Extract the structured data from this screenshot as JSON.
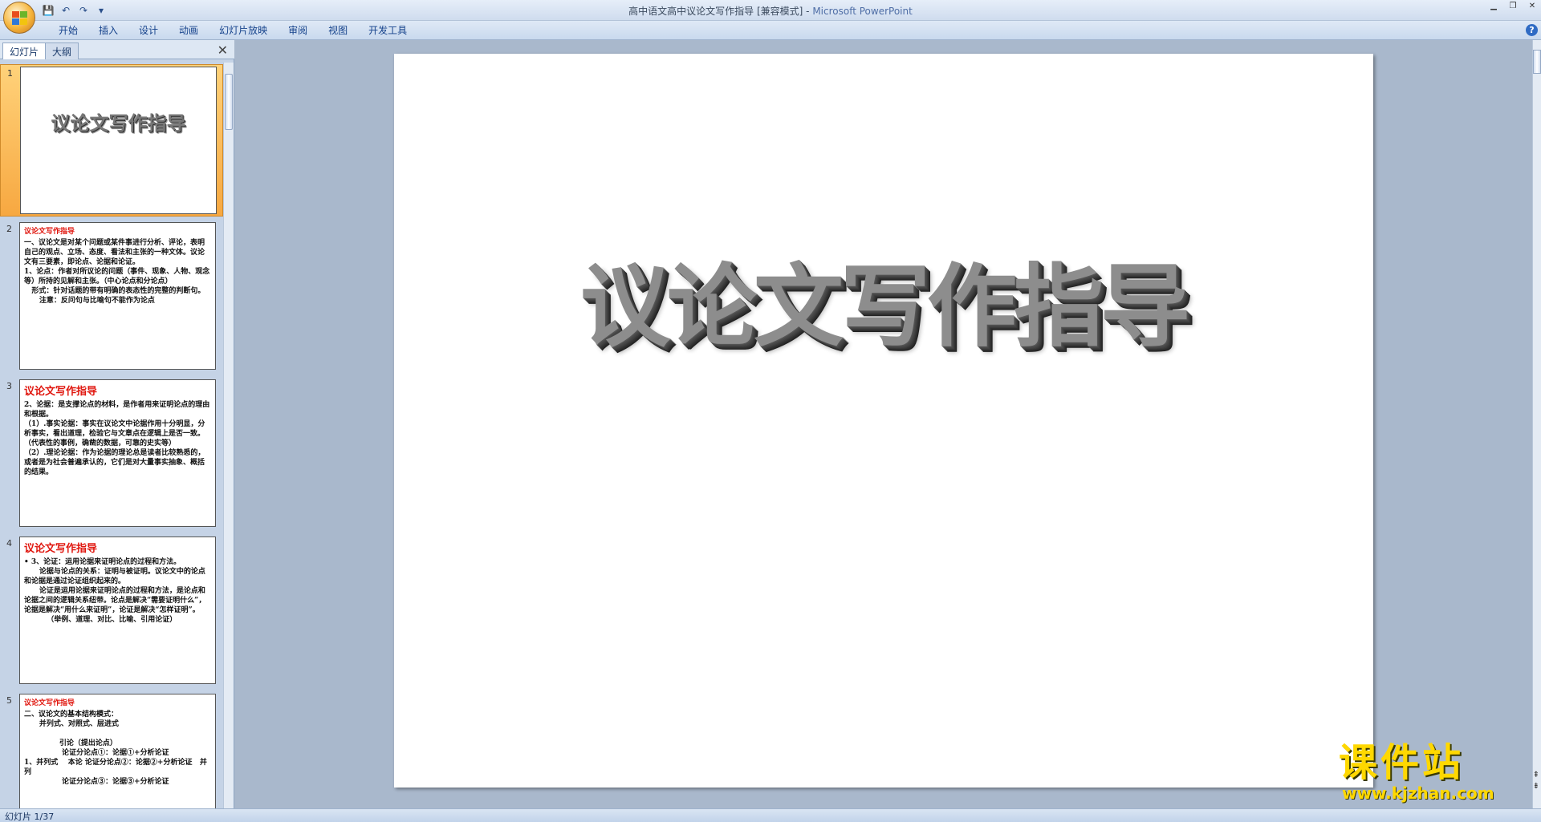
{
  "window": {
    "title": "高中语文高中议论文写作指导 [兼容模式]",
    "separator": " - ",
    "app_name": "Microsoft PowerPoint"
  },
  "qat": {
    "save": "💾",
    "undo": "↶",
    "redo": "↷",
    "customize": "▾"
  },
  "ribbon": {
    "tabs": [
      "开始",
      "插入",
      "设计",
      "动画",
      "幻灯片放映",
      "审阅",
      "视图",
      "开发工具"
    ],
    "help": "?"
  },
  "pane": {
    "tab_slides": "幻灯片",
    "tab_outline": "大纲",
    "close": "✕"
  },
  "thumbnails": [
    {
      "num": "1",
      "center": "议论文写作指导"
    },
    {
      "num": "2",
      "title": "议论文写作指导",
      "body": "一、议论文是对某个问题或某件事进行分析、评论，表明自己的观点、立场、态度、看法和主张的一种文体。议论文有三要素，即论点、论据和论证。\n1、论点：作者对所议论的问题（事件、现象、人物、观念等）所持的见解和主张。（中心论点和分论点）\n   形式：针对话题的带有明确的表态性的完整的判断句。\n      注意：反问句与比喻句不能作为论点"
    },
    {
      "num": "3",
      "title": "议论文写作指导",
      "body": "2、论据：是支撑论点的材料，是作者用来证明论点的理由和根据。\n（1）.事实论据：事实在议论文中论据作用十分明显，分析事实，看出道理，检验它与文章点在逻辑上是否一致。（代表性的事例，确凿的数据，可靠的史实等）\n（2）.理论论据：作为论据的理论总是读者比较熟悉的，或者是为社会普遍承认的，它们是对大量事实抽象、概括的结果。"
    },
    {
      "num": "4",
      "title": "议论文写作指导",
      "body": "• 3、论证：运用论据来证明论点的过程和方法。\n      论据与论点的关系：证明与被证明。议论文中的论点和论据是通过论证组织起来的。\n      论证是运用论据来证明论点的过程和方法，是论点和论据之间的逻辑关系纽带。论点是解决“需要证明什么”，论据是解决“用什么来证明”，论证是解决“怎样证明”。\n         （举例、道理、对比、比喻、引用论证）"
    },
    {
      "num": "5",
      "title": "议论文写作指导",
      "body": "二、议论文的基本结构模式：\n      并列式、对照式、层进式\n\n              引论（提出论点）\n               论证分论点①：论据①+分析论证\n1、并列式    本论 论证分论点②：论据②+分析论证   并列\n               论证分论点③：论据③+分析论证"
    }
  ],
  "slide": {
    "title": "议论文写作指导"
  },
  "status": {
    "slide_info": "幻灯片 1/37"
  },
  "watermark": {
    "name": "课件站",
    "url": "www.kjzhan.com"
  }
}
